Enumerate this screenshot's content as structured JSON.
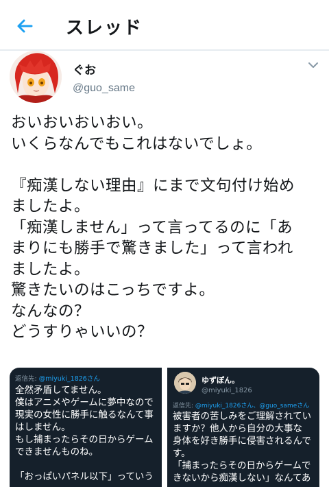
{
  "header": {
    "title": "スレッド",
    "back_icon": "arrow-left-icon",
    "accent_color": "#1da1f2"
  },
  "tweet": {
    "display_name": "ぐお",
    "handle": "@guo_same",
    "caret_icon": "chevron-down-icon",
    "text_lines": [
      "おいおいおいおい。",
      "いくらなんでもこれはないでしょ。",
      "",
      "『痴漢しない理由』にまで文句付け始め",
      "ましたよ。",
      "「痴漢しません」って言ってるのに「あ",
      "まりにも勝手で驚きました」って言われ",
      "ましたよ。",
      "驚きたいのはこっちですよ。",
      "なんなの？",
      "どうすりゃいいの？"
    ]
  },
  "media": {
    "left": {
      "reply_prefix": "返信先: ",
      "reply_mention": "@miyuki_1826さん",
      "text_lines": [
        "全然矛盾してません。",
        "僕はアニメやゲームに夢中なので",
        "現実の女性に勝手に触るなんて事",
        "はしません。",
        "もし捕まったらその日からゲーム",
        "できませんものね。",
        "",
        "「おっぱいパネル以下」っていう"
      ]
    },
    "right": {
      "display_name": "ゆずぽん。",
      "handle": "@miyuki_1826",
      "reply_prefix": "返信先: ",
      "reply_mention": "@miyuki_1826さん、@guo_sameさん",
      "text_lines": [
        "被害者の苦しみをご理解されてい",
        "ますか？他人から自分の大事な",
        "身体を好き勝手に侵害されるんで",
        "す。",
        "「捕まったらその日からゲームで",
        "きないから痴漢しない」なんてあ"
      ]
    }
  }
}
